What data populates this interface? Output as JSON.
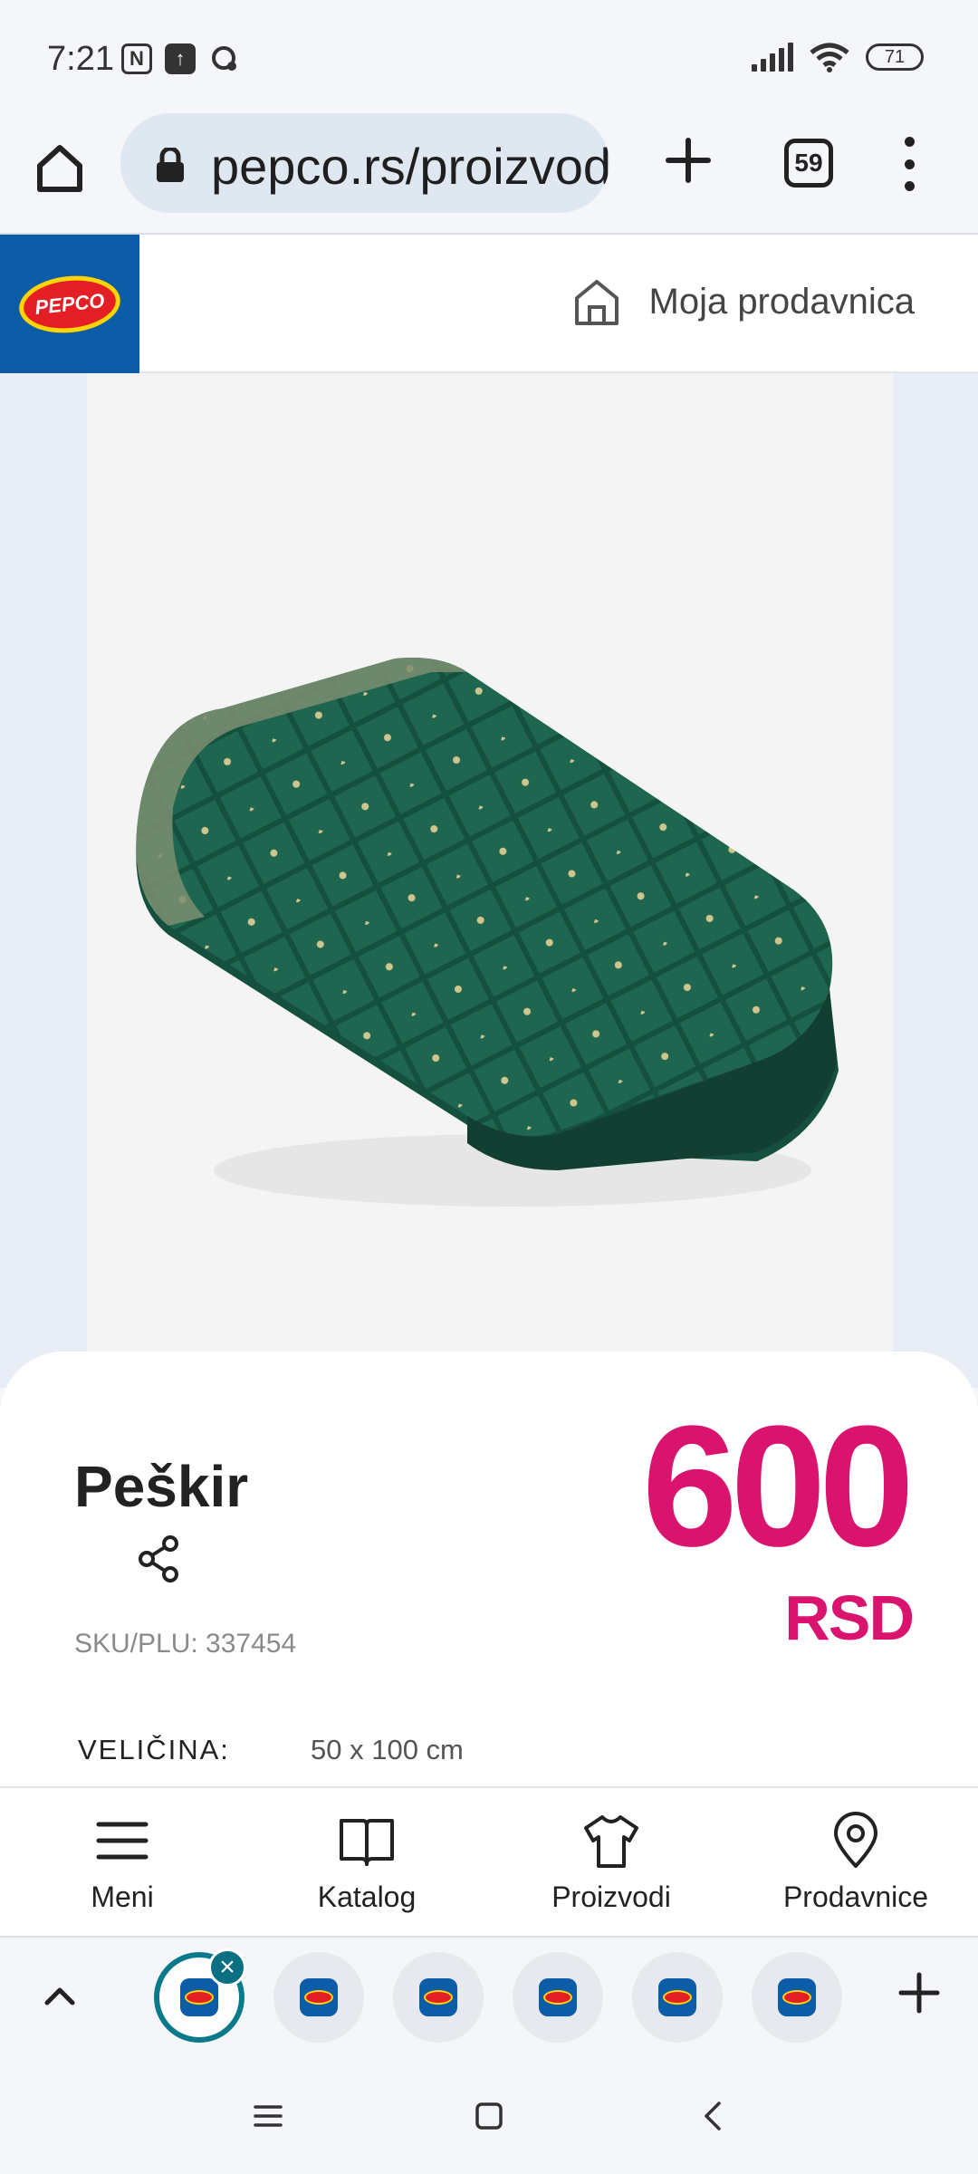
{
  "status_bar": {
    "time": "7:21",
    "battery": "71",
    "icons": [
      "nfc-icon",
      "upload-icon",
      "chat-icon",
      "signal-icon",
      "wifi-icon",
      "battery-icon"
    ]
  },
  "browser": {
    "url": "pepco.rs/proizvod",
    "tab_count": "59"
  },
  "site_header": {
    "logo_text": "PEPCO",
    "store_link": "Moja prodavnica"
  },
  "product": {
    "name": "Peškir",
    "sku": "SKU/PLU: 337454",
    "price": "600",
    "currency": "RSD",
    "size_label": "VELIČINA:",
    "size_value": "50 x 100 cm",
    "image_alt": "green towel"
  },
  "site_nav": {
    "items": [
      {
        "label": "Meni",
        "icon": "menu-icon"
      },
      {
        "label": "Katalog",
        "icon": "book-icon"
      },
      {
        "label": "Proizvodi",
        "icon": "shirt-icon"
      },
      {
        "label": "Prodavnice",
        "icon": "location-pin-icon"
      }
    ]
  },
  "tab_strip": {
    "tabs": 6,
    "active_index": 0
  },
  "colors": {
    "brand_blue": "#0d5ca8",
    "price_magenta": "#d9136e",
    "active_teal": "#0a7a8a"
  }
}
